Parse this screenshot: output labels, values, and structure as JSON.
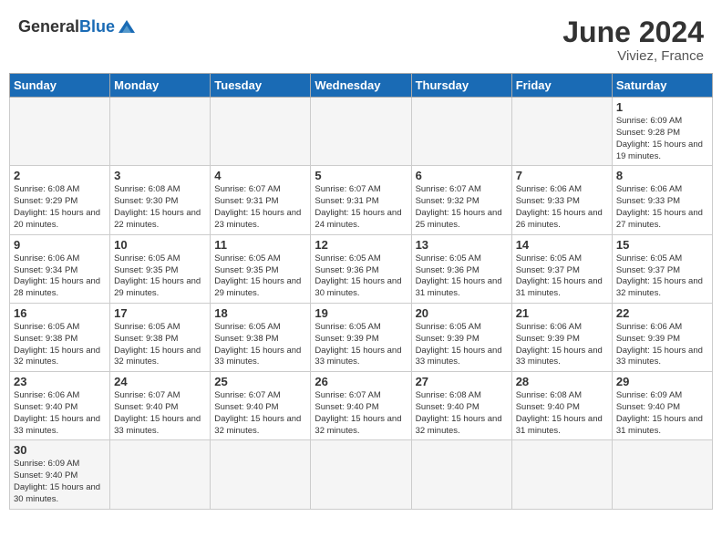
{
  "header": {
    "logo_general": "General",
    "logo_blue": "Blue",
    "month_year": "June 2024",
    "location": "Viviez, France"
  },
  "weekdays": [
    "Sunday",
    "Monday",
    "Tuesday",
    "Wednesday",
    "Thursday",
    "Friday",
    "Saturday"
  ],
  "days": [
    {
      "date": "",
      "info": ""
    },
    {
      "date": "",
      "info": ""
    },
    {
      "date": "",
      "info": ""
    },
    {
      "date": "",
      "info": ""
    },
    {
      "date": "",
      "info": ""
    },
    {
      "date": "",
      "info": ""
    },
    {
      "date": "1",
      "info": "Sunrise: 6:09 AM\nSunset: 9:28 PM\nDaylight: 15 hours and 19 minutes."
    },
    {
      "date": "2",
      "info": "Sunrise: 6:08 AM\nSunset: 9:29 PM\nDaylight: 15 hours and 20 minutes."
    },
    {
      "date": "3",
      "info": "Sunrise: 6:08 AM\nSunset: 9:30 PM\nDaylight: 15 hours and 22 minutes."
    },
    {
      "date": "4",
      "info": "Sunrise: 6:07 AM\nSunset: 9:31 PM\nDaylight: 15 hours and 23 minutes."
    },
    {
      "date": "5",
      "info": "Sunrise: 6:07 AM\nSunset: 9:31 PM\nDaylight: 15 hours and 24 minutes."
    },
    {
      "date": "6",
      "info": "Sunrise: 6:07 AM\nSunset: 9:32 PM\nDaylight: 15 hours and 25 minutes."
    },
    {
      "date": "7",
      "info": "Sunrise: 6:06 AM\nSunset: 9:33 PM\nDaylight: 15 hours and 26 minutes."
    },
    {
      "date": "8",
      "info": "Sunrise: 6:06 AM\nSunset: 9:33 PM\nDaylight: 15 hours and 27 minutes."
    },
    {
      "date": "9",
      "info": "Sunrise: 6:06 AM\nSunset: 9:34 PM\nDaylight: 15 hours and 28 minutes."
    },
    {
      "date": "10",
      "info": "Sunrise: 6:05 AM\nSunset: 9:35 PM\nDaylight: 15 hours and 29 minutes."
    },
    {
      "date": "11",
      "info": "Sunrise: 6:05 AM\nSunset: 9:35 PM\nDaylight: 15 hours and 29 minutes."
    },
    {
      "date": "12",
      "info": "Sunrise: 6:05 AM\nSunset: 9:36 PM\nDaylight: 15 hours and 30 minutes."
    },
    {
      "date": "13",
      "info": "Sunrise: 6:05 AM\nSunset: 9:36 PM\nDaylight: 15 hours and 31 minutes."
    },
    {
      "date": "14",
      "info": "Sunrise: 6:05 AM\nSunset: 9:37 PM\nDaylight: 15 hours and 31 minutes."
    },
    {
      "date": "15",
      "info": "Sunrise: 6:05 AM\nSunset: 9:37 PM\nDaylight: 15 hours and 32 minutes."
    },
    {
      "date": "16",
      "info": "Sunrise: 6:05 AM\nSunset: 9:38 PM\nDaylight: 15 hours and 32 minutes."
    },
    {
      "date": "17",
      "info": "Sunrise: 6:05 AM\nSunset: 9:38 PM\nDaylight: 15 hours and 32 minutes."
    },
    {
      "date": "18",
      "info": "Sunrise: 6:05 AM\nSunset: 9:38 PM\nDaylight: 15 hours and 33 minutes."
    },
    {
      "date": "19",
      "info": "Sunrise: 6:05 AM\nSunset: 9:39 PM\nDaylight: 15 hours and 33 minutes."
    },
    {
      "date": "20",
      "info": "Sunrise: 6:05 AM\nSunset: 9:39 PM\nDaylight: 15 hours and 33 minutes."
    },
    {
      "date": "21",
      "info": "Sunrise: 6:06 AM\nSunset: 9:39 PM\nDaylight: 15 hours and 33 minutes."
    },
    {
      "date": "22",
      "info": "Sunrise: 6:06 AM\nSunset: 9:39 PM\nDaylight: 15 hours and 33 minutes."
    },
    {
      "date": "23",
      "info": "Sunrise: 6:06 AM\nSunset: 9:40 PM\nDaylight: 15 hours and 33 minutes."
    },
    {
      "date": "24",
      "info": "Sunrise: 6:07 AM\nSunset: 9:40 PM\nDaylight: 15 hours and 33 minutes."
    },
    {
      "date": "25",
      "info": "Sunrise: 6:07 AM\nSunset: 9:40 PM\nDaylight: 15 hours and 32 minutes."
    },
    {
      "date": "26",
      "info": "Sunrise: 6:07 AM\nSunset: 9:40 PM\nDaylight: 15 hours and 32 minutes."
    },
    {
      "date": "27",
      "info": "Sunrise: 6:08 AM\nSunset: 9:40 PM\nDaylight: 15 hours and 32 minutes."
    },
    {
      "date": "28",
      "info": "Sunrise: 6:08 AM\nSunset: 9:40 PM\nDaylight: 15 hours and 31 minutes."
    },
    {
      "date": "29",
      "info": "Sunrise: 6:09 AM\nSunset: 9:40 PM\nDaylight: 15 hours and 31 minutes."
    },
    {
      "date": "30",
      "info": "Sunrise: 6:09 AM\nSunset: 9:40 PM\nDaylight: 15 hours and 30 minutes."
    },
    {
      "date": "",
      "info": ""
    },
    {
      "date": "",
      "info": ""
    },
    {
      "date": "",
      "info": ""
    },
    {
      "date": "",
      "info": ""
    },
    {
      "date": "",
      "info": ""
    },
    {
      "date": "",
      "info": ""
    }
  ]
}
